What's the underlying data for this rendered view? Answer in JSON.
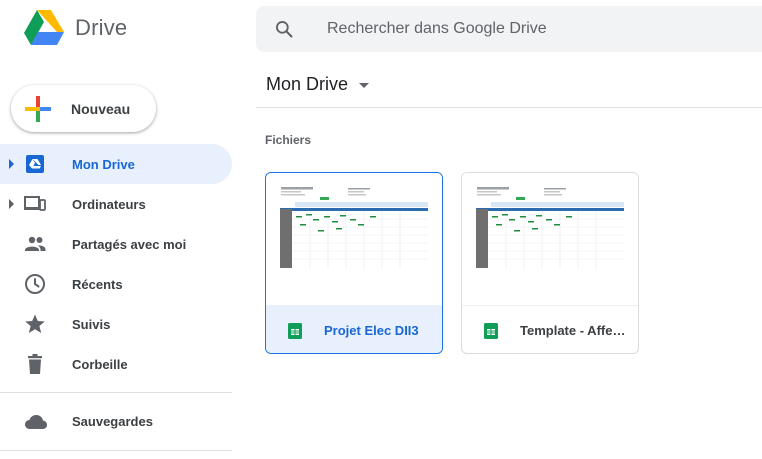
{
  "app": {
    "name": "Drive"
  },
  "search": {
    "placeholder": "Rechercher dans Google Drive"
  },
  "new_button": {
    "label": "Nouveau"
  },
  "sidebar": {
    "items": [
      {
        "label": "Mon Drive",
        "icon": "my-drive-icon",
        "active": true,
        "expandable": true
      },
      {
        "label": "Ordinateurs",
        "icon": "computers-icon",
        "active": false,
        "expandable": true
      },
      {
        "label": "Partagés avec moi",
        "icon": "shared-icon",
        "active": false,
        "expandable": false
      },
      {
        "label": "Récents",
        "icon": "clock-icon",
        "active": false,
        "expandable": false
      },
      {
        "label": "Suivis",
        "icon": "star-icon",
        "active": false,
        "expandable": false
      },
      {
        "label": "Corbeille",
        "icon": "trash-icon",
        "active": false,
        "expandable": false
      }
    ],
    "backup": {
      "label": "Sauvegardes",
      "icon": "cloud-icon"
    }
  },
  "main": {
    "title": "Mon Drive",
    "section_label": "Fichiers",
    "files": [
      {
        "name": "Projet Elec DII3",
        "type": "spreadsheet",
        "selected": true
      },
      {
        "name": "Template - Affectation",
        "type": "spreadsheet",
        "selected": false
      }
    ]
  },
  "colors": {
    "accent": "#1967d2",
    "selected_bg": "#e8f0fe",
    "sheets_green": "#0f9d58",
    "search_bg": "#f1f3f4"
  }
}
